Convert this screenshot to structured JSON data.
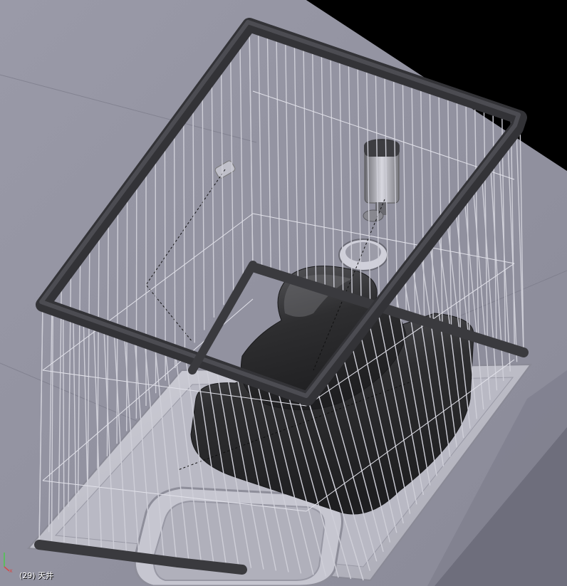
{
  "viewport": {
    "object_label": "(29) 天井"
  },
  "axis": {
    "x_label": "x",
    "z_label": "z"
  },
  "colors": {
    "background": "#000000",
    "ground": "#8a8a98",
    "ground_light": "#a4a4b2",
    "frame": "#3a3a3e",
    "frame_highlight": "#55555a",
    "bars": "#c9c9d3",
    "tray": "#c2c2cc",
    "cushion": "#2a2a2c",
    "cushion_highlight": "#5a5a5e",
    "axis_x": "#d24a4a",
    "axis_y": "#4ac84a"
  }
}
